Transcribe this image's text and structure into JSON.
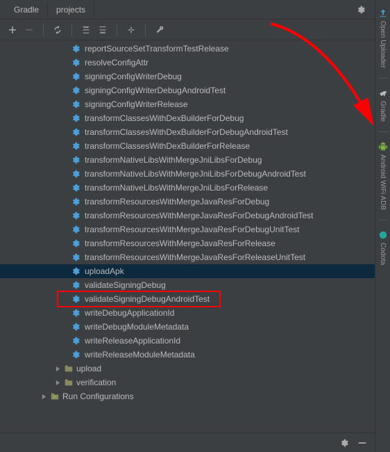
{
  "tabs": {
    "gradle": "Gradle",
    "projects": "projects"
  },
  "tasks": [
    "reportSourceSetTransformTestRelease",
    "resolveConfigAttr",
    "signingConfigWriterDebug",
    "signingConfigWriterDebugAndroidTest",
    "signingConfigWriterRelease",
    "transformClassesWithDexBuilderForDebug",
    "transformClassesWithDexBuilderForDebugAndroidTest",
    "transformClassesWithDexBuilderForRelease",
    "transformNativeLibsWithMergeJniLibsForDebug",
    "transformNativeLibsWithMergeJniLibsForDebugAndroidTest",
    "transformNativeLibsWithMergeJniLibsForRelease",
    "transformResourcesWithMergeJavaResForDebug",
    "transformResourcesWithMergeJavaResForDebugAndroidTest",
    "transformResourcesWithMergeJavaResForDebugUnitTest",
    "transformResourcesWithMergeJavaResForRelease",
    "transformResourcesWithMergeJavaResForReleaseUnitTest",
    "uploadApk",
    "validateSigningDebug",
    "validateSigningDebugAndroidTest",
    "writeDebugApplicationId",
    "writeDebugModuleMetadata",
    "writeReleaseApplicationId",
    "writeReleaseModuleMetadata"
  ],
  "selected_task_index": 16,
  "folders": [
    "upload",
    "verification"
  ],
  "runConfig": "Run Configurations",
  "sidebar": {
    "items": [
      "Open Uploader",
      "Gradle",
      "Android WiFi ADB",
      "Codota"
    ]
  },
  "colors": {
    "gear": "#4a9fd8",
    "folder": "#8a8a62",
    "green": "#7cb342",
    "codota": "#26a69a"
  }
}
